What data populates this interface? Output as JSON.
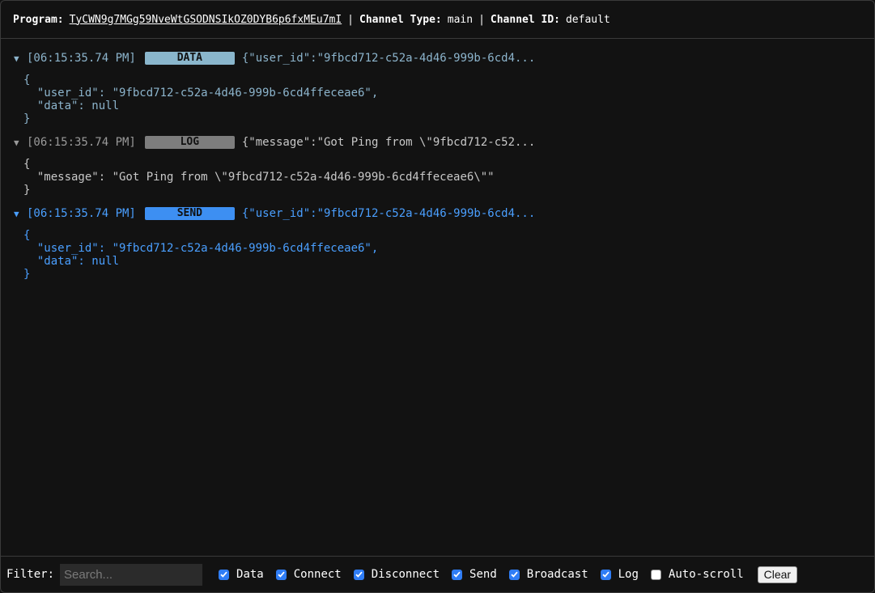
{
  "header": {
    "program_label": "Program:",
    "program_value": "TyCWN9g7MGg59NveWtGSODNSIkOZ0DYB6p6fxMEu7mI",
    "separator": "|",
    "channel_type_label": "Channel Type:",
    "channel_type_value": "main",
    "channel_id_label": "Channel ID:",
    "channel_id_value": "default"
  },
  "entries": [
    {
      "timestamp": "[06:15:35.74 PM]",
      "badge": "DATA",
      "preview": "{\"user_id\":\"9fbcd712-c52a-4d46-999b-6cd4...",
      "body": "{\n  \"user_id\": \"9fbcd712-c52a-4d46-999b-6cd4ffeceae6\",\n  \"data\": null\n}",
      "color": "#8cb4cc"
    },
    {
      "timestamp": "[06:15:35.74 PM]",
      "badge": "LOG",
      "preview": "{\"message\":\"Got Ping from \\\"9fbcd712-c52...",
      "body": "{\n  \"message\": \"Got Ping from \\\"9fbcd712-c52a-4d46-999b-6cd4ffeceae6\\\"\"\n}",
      "color": "#c8c8c8"
    },
    {
      "timestamp": "[06:15:35.74 PM]",
      "badge": "SEND",
      "preview": "{\"user_id\":\"9fbcd712-c52a-4d46-999b-6cd4...",
      "body": "{\n  \"user_id\": \"9fbcd712-c52a-4d46-999b-6cd4ffeceae6\",\n  \"data\": null\n}",
      "color": "#4a9fff"
    }
  ],
  "footer": {
    "filter_label": "Filter:",
    "search_placeholder": "Search...",
    "checkboxes": [
      {
        "label": "Data",
        "checked": true
      },
      {
        "label": "Connect",
        "checked": true
      },
      {
        "label": "Disconnect",
        "checked": true
      },
      {
        "label": "Send",
        "checked": true
      },
      {
        "label": "Broadcast",
        "checked": true
      },
      {
        "label": "Log",
        "checked": true
      },
      {
        "label": "Auto-scroll",
        "checked": false
      }
    ],
    "clear_label": "Clear"
  },
  "icons": {
    "caret": "caret-down-icon",
    "check": "checkmark-icon"
  }
}
